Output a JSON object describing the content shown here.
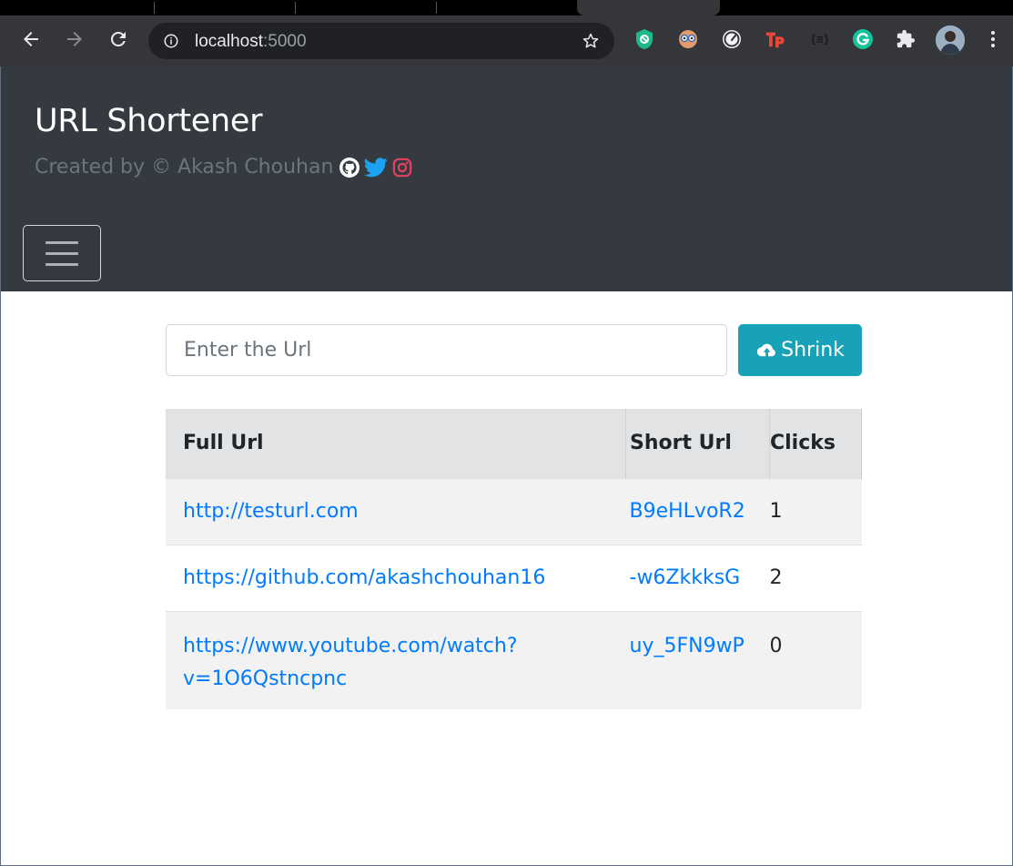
{
  "browser": {
    "address": "localhost",
    "port": ":5000"
  },
  "header": {
    "title": "URL Shortener",
    "byline": "Created by © Akash Chouhan",
    "social": [
      "github-icon",
      "twitter-icon",
      "instagram-icon"
    ]
  },
  "form": {
    "placeholder": "Enter the Url",
    "button_label": "Shrink"
  },
  "table": {
    "headers": [
      "Full Url",
      "Short Url",
      "Clicks"
    ],
    "rows": [
      {
        "full": "http://testurl.com",
        "short": "B9eHLvoR2",
        "clicks": "1"
      },
      {
        "full": "https://github.com/akashchouhan16",
        "short": "-w6ZkkksG",
        "clicks": "2"
      },
      {
        "full_line1": "https://www.youtube.com/watch?",
        "full_line2": "v=1O6Qstncpnc",
        "short": "uy_5FN9wP",
        "clicks": "0"
      }
    ]
  },
  "colors": {
    "jumbotron": "#343a40",
    "button": "#17a2b8",
    "link": "#007bff"
  }
}
